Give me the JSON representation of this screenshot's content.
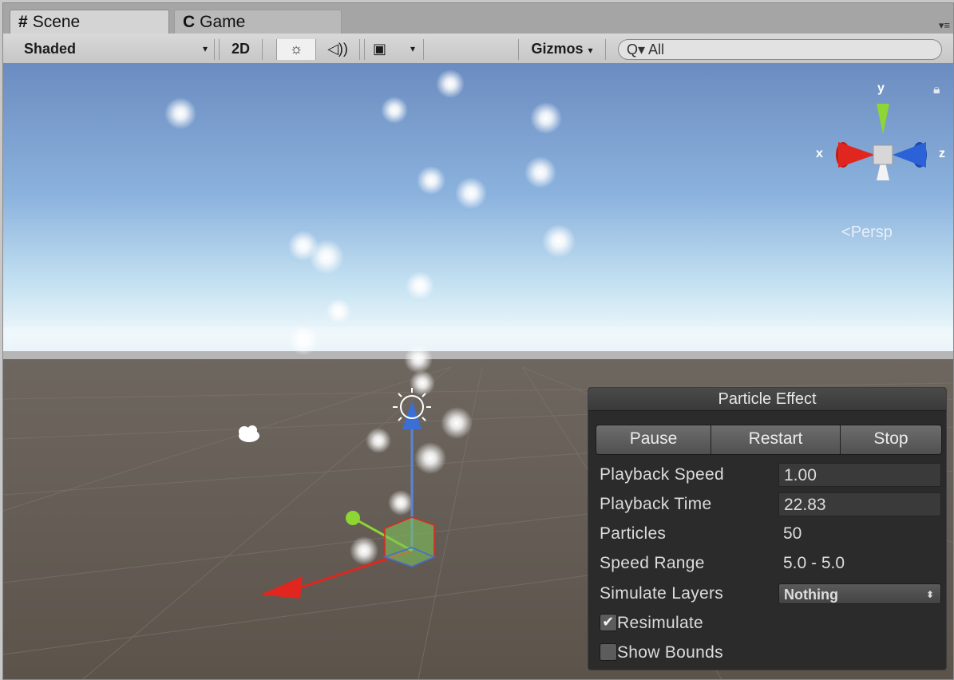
{
  "tabs": [
    {
      "label": "Scene",
      "icon": "grid-icon",
      "glyph": "#",
      "active": true
    },
    {
      "label": "Game",
      "icon": "pacman-icon",
      "glyph": "C",
      "active": false
    }
  ],
  "toolbar": {
    "shading_mode": "Shaded",
    "mode_2d": "2D",
    "gizmos": "Gizmos",
    "search_value": "All",
    "search_glyph": "Q▾"
  },
  "gizmo": {
    "x_label": "x",
    "y_label": "y",
    "z_label": "z",
    "projection": "Persp"
  },
  "particle_panel": {
    "title": "Particle Effect",
    "buttons": [
      "Pause",
      "Restart",
      "Stop"
    ],
    "rows": [
      {
        "label": "Playback Speed",
        "value": "1.00"
      },
      {
        "label": "Playback Time",
        "value": "22.83"
      },
      {
        "label": "Particles",
        "value": "50"
      },
      {
        "label": "Speed Range",
        "value": "5.0 - 5.0"
      },
      {
        "label": "Simulate Layers",
        "value": "Nothing"
      }
    ],
    "checkboxes": [
      {
        "label": "Resimulate",
        "checked": true
      },
      {
        "label": "Show Bounds",
        "checked": false
      }
    ]
  },
  "colors": {
    "x_axis": "#e0261f",
    "y_axis": "#8dd633",
    "z_axis": "#2c62d8",
    "sky_top": "#6b8fc4",
    "ground": "#645b52"
  }
}
